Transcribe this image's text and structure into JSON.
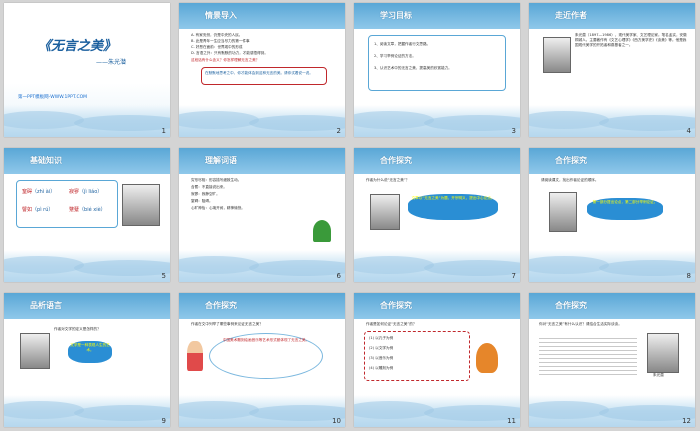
{
  "slides": [
    {
      "num": "1",
      "title": "《无言之美》",
      "author": "——朱光潜",
      "link": "第一PPT模板网-WWW.1PPT.COM"
    },
    {
      "num": "2",
      "heading": "情景导入",
      "lines": [
        "A. 有家安然，仍是中央的人民。",
        "B. 此是青年一生应当尽力的第一件事",
        "C. 好恶在面前：世界观中的形成",
        "D. 言语之外：只有默默的功力，才能感悟得到。"
      ],
      "question": "这段话有什么含义？你怎样理解无言之美？",
      "note": "在默默地思考之中，你才能体会到这种无言的美。请你试着说一说。"
    },
    {
      "num": "3",
      "heading": "学习目标",
      "goals": [
        "1、阅读文章，把握作者行文思路。",
        "2、学习举例论证的方法。",
        "3、认识艺术中的无言之美，提高美的欣赏能力。"
      ]
    },
    {
      "num": "4",
      "heading": "走近作者",
      "bio": "朱光潜（1897—1986），现代美学家、文艺理论家。笔名孟实，安徽桐城人。主要著作有《文艺心理学》《西方美学史》《谈美》等。他是我国现代美学的开拓者和奠基者之一。"
    },
    {
      "num": "5",
      "heading": "基础知识",
      "words": [
        {
          "w": "窒碍",
          "p": "（zhì ài）"
        },
        {
          "w": "寂寥",
          "p": "（jì liáo）"
        },
        {
          "w": "譬如",
          "p": "（pì rú）"
        },
        {
          "w": "蹩躠",
          "p": "（bié xiè）"
        }
      ]
    },
    {
      "num": "6",
      "heading": "理解词语",
      "terms": [
        "穷形尽相：形容描写细致生动。",
        "含蓄：不直接说出来。",
        "寂寥：寂静空旷。",
        "窒碍：阻碍。",
        "心旷神怡：心境开阔，精神愉快。"
      ]
    },
    {
      "num": "7",
      "heading": "合作探究",
      "question": "作者为什么说“无言之美”？",
      "answer": "文章以“无言之美”为题，开宗明义，提出中心论点。"
    },
    {
      "num": "8",
      "heading": "合作探究",
      "question": "请阅读课文，找出作者论证的顺序。",
      "answer": "第一部分提出论点，第二部分举例论证。"
    },
    {
      "num": "9",
      "heading": "品析语言",
      "question": "作者对文学的定义是怎样的？",
      "answer": "文学是一种表现人生的艺术。"
    },
    {
      "num": "10",
      "heading": "合作探究",
      "text": "作者在文中列举了哪些事例来论证无言之美？",
      "answer": "中国美术雕刻绘画音乐等艺术形式都体现了无言之美。"
    },
    {
      "num": "11",
      "heading": "合作探究",
      "text": "作者是如何论证“无言之美”的？",
      "points": [
        "(1) 以孔子为例",
        "(2) 以文学为例",
        "(3) 以音乐为例",
        "(4) 以雕刻为例"
      ]
    },
    {
      "num": "12",
      "heading": "合作探究",
      "text": "你对“无言之美”有什么认识？请结合生活实际谈谈。",
      "caption": "朱光潜"
    }
  ]
}
